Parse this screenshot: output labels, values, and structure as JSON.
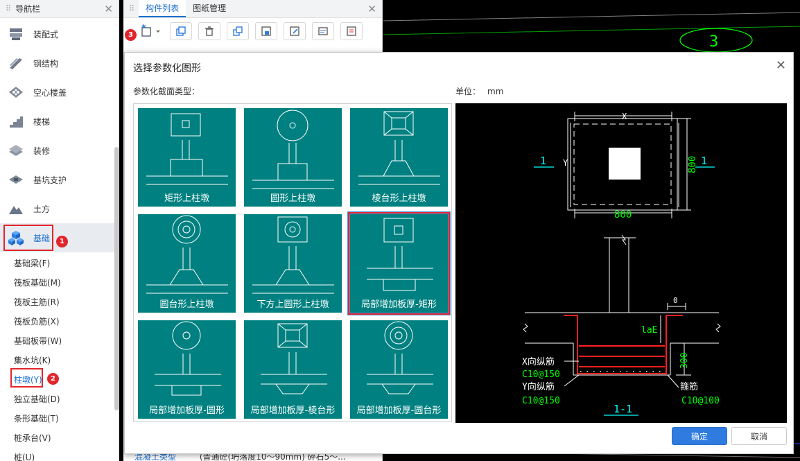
{
  "nav": {
    "title": "导航栏",
    "items": [
      {
        "label": "装配式",
        "icon": "prefab-icon"
      },
      {
        "label": "钢结构",
        "icon": "steel-structure-icon"
      },
      {
        "label": "空心楼盖",
        "icon": "hollow-floor-icon"
      },
      {
        "label": "楼梯",
        "icon": "stair-icon"
      },
      {
        "label": "装修",
        "icon": "decoration-icon"
      },
      {
        "label": "基坑支护",
        "icon": "pit-support-icon"
      },
      {
        "label": "土方",
        "icon": "earthwork-icon"
      },
      {
        "label": "基础",
        "icon": "foundation-icon"
      }
    ],
    "sub_items": [
      "基础梁(F)",
      "筏板基础(M)",
      "筏板主筋(R)",
      "筏板负筋(X)",
      "基础板带(W)",
      "集水坑(K)",
      "柱墩(Y)",
      "独立基础(D)",
      "条形基础(T)",
      "桩承台(V)",
      "桩(U)"
    ],
    "badges": [
      "1",
      "2"
    ]
  },
  "comp_panel": {
    "tabs": [
      "构件列表",
      "图纸管理"
    ],
    "badge": "3",
    "bottom_label": "混凝土类型",
    "bottom_value": "(普通砼(坍落度10～90mm) 碎石5～..."
  },
  "cad": {
    "marker": "3"
  },
  "dialog": {
    "title": "选择参数化图形",
    "section_label": "参数化截面类型：",
    "unit_label": "单位：",
    "unit_value": "mm",
    "shapes": [
      "矩形上柱墩",
      "圆形上柱墩",
      "棱台形上柱墩",
      "圆台形上柱墩",
      "下方上圆形上柱墩",
      "局部增加板厚-矩形",
      "局部增加板厚-圆形",
      "局部增加板厚-棱台形",
      "局部增加板厚-圆台形"
    ],
    "selected": "局部增加板厚-矩形",
    "preview": {
      "dim_x": "X",
      "dim_y": "Y",
      "dim_800_h": "800",
      "dim_800_v": "800",
      "sec_left": "1",
      "sec_right": "1",
      "dim_0": "0",
      "dim_lae": "laE",
      "dim_300": "300",
      "x_bar": "X向纵筋",
      "x_bar_val": "C10@150",
      "y_bar": "Y向纵筋",
      "y_bar_val": "C10@150",
      "stirrup": "箍筋",
      "stirrup_val": "C10@100",
      "section_name": "1-1"
    },
    "ok": "确定",
    "cancel": "取消"
  },
  "colors": {
    "accent": "#1a6fd1",
    "highlight": "#e1252c",
    "tile": "#008080",
    "cad_green": "#00ff00",
    "cad_cyan": "#00ffff"
  }
}
